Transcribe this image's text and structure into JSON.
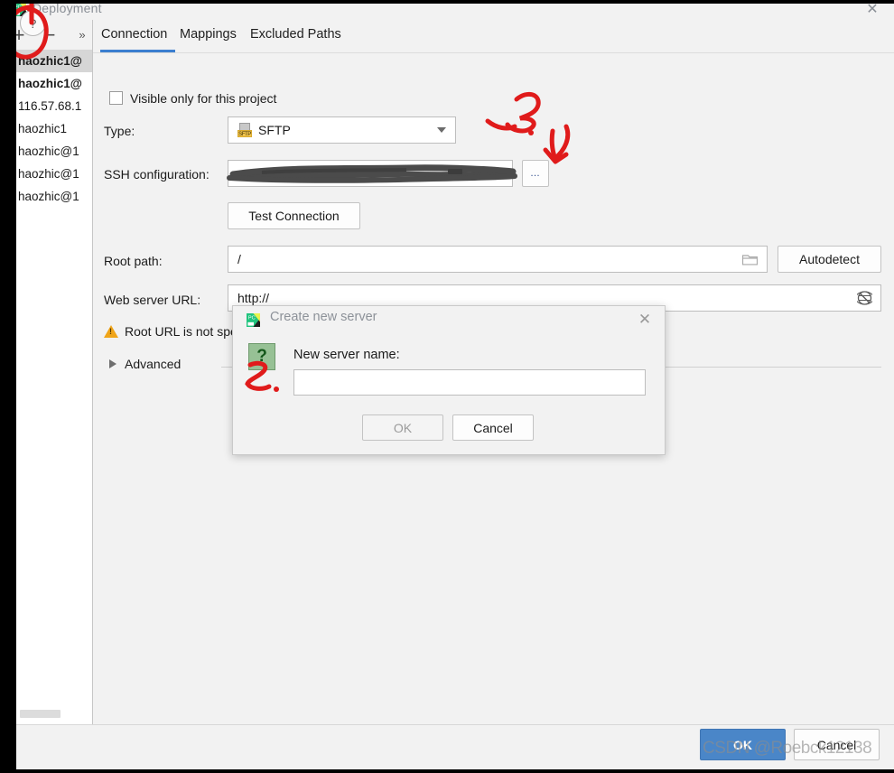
{
  "window": {
    "title": "Deployment",
    "app_icon": "pycharm-icon",
    "close_label": "✕"
  },
  "left_panel": {
    "toolbar": {
      "add_label": "+",
      "remove_label": "−",
      "more_label": "»"
    },
    "servers": [
      {
        "label": "haozhic1@",
        "icon": "sftp-file-icon",
        "bold": true,
        "selected": true
      },
      {
        "label": "haozhic1@",
        "icon": "sftp-file-icon",
        "bold": true,
        "selected": false
      },
      {
        "label": "116.57.68.1",
        "icon": "sftp-file-icon",
        "bold": false,
        "selected": false
      },
      {
        "label": "haozhic1",
        "icon": "sftp-file-icon",
        "bold": false,
        "selected": false
      },
      {
        "label": "haozhic@1",
        "icon": "sftp-file-icon",
        "bold": false,
        "selected": false
      },
      {
        "label": "haozhic@1",
        "icon": "sftp-file-icon",
        "bold": false,
        "selected": false
      },
      {
        "label": "haozhic@1",
        "icon": "sftp-file-icon",
        "bold": false,
        "selected": false
      }
    ]
  },
  "tabs": [
    {
      "label": "Connection",
      "active": true
    },
    {
      "label": "Mappings",
      "active": false
    },
    {
      "label": "Excluded Paths",
      "active": false
    }
  ],
  "connection": {
    "visible_only_label": "Visible only for this project",
    "visible_only_checked": false,
    "type_label": "Type:",
    "type_value": "SFTP",
    "type_icon": "sftp-file-icon",
    "ssh_config_label": "SSH configuration:",
    "ssh_config_value": "",
    "ssh_browse_label": "…",
    "test_connection_label": "Test Connection",
    "root_path_label": "Root path:",
    "root_path_value": "/",
    "root_path_browse_icon": "folder-icon",
    "autodetect_label": "Autodetect",
    "web_url_label": "Web server URL:",
    "web_url_value": "http://",
    "web_url_open_icon": "globe-icon",
    "warning_text": "Root URL is not specified",
    "warning_icon": "warning-triangle-icon",
    "advanced_label": "Advanced"
  },
  "modal": {
    "title": "Create new server",
    "app_icon": "pycharm-icon",
    "question_icon": "question-mark-icon",
    "question_glyph": "?",
    "field_label": "New server name:",
    "field_value": "",
    "ok_label": "OK",
    "cancel_label": "Cancel",
    "close_label": "✕"
  },
  "footer": {
    "help_label": "?",
    "ok_label": "OK",
    "cancel_label": "Cancel"
  },
  "watermark": "CSDN @Roebck12138",
  "annotations": [
    {
      "name": "red-circle-on-add-button",
      "text": ""
    },
    {
      "name": "red-mark-step-3",
      "text": "3."
    },
    {
      "name": "red-mark-step-2",
      "text": "2."
    }
  ],
  "colors": {
    "accent_blue": "#3c7fd0",
    "ok_button_blue": "#4a86c8",
    "annotation_red": "#e01b1b",
    "warning_orange": "#f0a519",
    "question_green": "#97c195"
  }
}
